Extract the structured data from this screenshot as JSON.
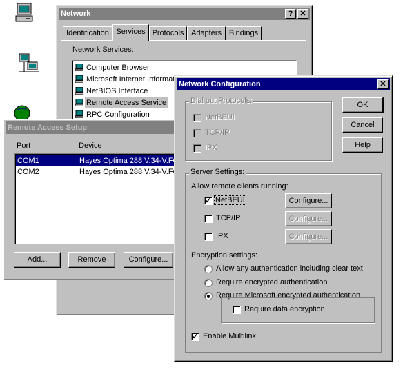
{
  "desktop": {
    "icons": [
      "computer-icon",
      "network-computers-icon",
      "globe-icon"
    ]
  },
  "network_window": {
    "title": "Network",
    "title_buttons": [
      "?",
      "✕"
    ],
    "tabs": [
      "Identification",
      "Services",
      "Protocols",
      "Adapters",
      "Bindings"
    ],
    "active_tab": "Services",
    "services_label": "Network Services:",
    "services": [
      "Computer Browser",
      "Microsoft Internet Informati",
      "NetBIOS Interface",
      "Remote Access Service",
      "RPC Configuration"
    ],
    "selected_service": "Remote Access Service"
  },
  "ras_window": {
    "title": "Remote Access Setup",
    "col_port": "Port",
    "col_device": "Device",
    "rows": [
      {
        "port": "COM1",
        "device": "Hayes Optima 288 V.34-V.FC"
      },
      {
        "port": "COM2",
        "device": "Hayes Optima 288 V.34-V.FC"
      }
    ],
    "buttons": {
      "add": "Add...",
      "remove": "Remove",
      "configure": "Configure..."
    }
  },
  "netconfig_window": {
    "title": "Network Configuration",
    "close": "✕",
    "dialout": {
      "label": "Dial out Protocols:",
      "items": [
        {
          "label": "NetBEUI",
          "checked": false
        },
        {
          "label": "TCP/IP",
          "checked": false
        },
        {
          "label": "IPX",
          "checked": false
        }
      ]
    },
    "buttons": {
      "ok": "OK",
      "cancel": "Cancel",
      "help": "Help"
    },
    "server": {
      "label": "Server Settings:",
      "allow_label": "Allow remote clients running:",
      "protocols": [
        {
          "label": "NetBEUI",
          "checked": true,
          "configure": "Configure..."
        },
        {
          "label": "TCP/IP",
          "checked": false,
          "configure": "Configure..."
        },
        {
          "label": "IPX",
          "checked": false,
          "configure": "Configure..."
        }
      ],
      "encryption_label": "Encryption settings:",
      "encryption_options": [
        {
          "label": "Allow any authentication including clear text",
          "selected": false
        },
        {
          "label": "Require encrypted authentication",
          "selected": false
        },
        {
          "label": "Require Microsoft encrypted authentication",
          "selected": true
        }
      ],
      "require_data_encryption": {
        "label": "Require data encryption",
        "checked": false
      },
      "enable_multilink": {
        "label": "Enable Multilink",
        "checked": true
      }
    }
  }
}
